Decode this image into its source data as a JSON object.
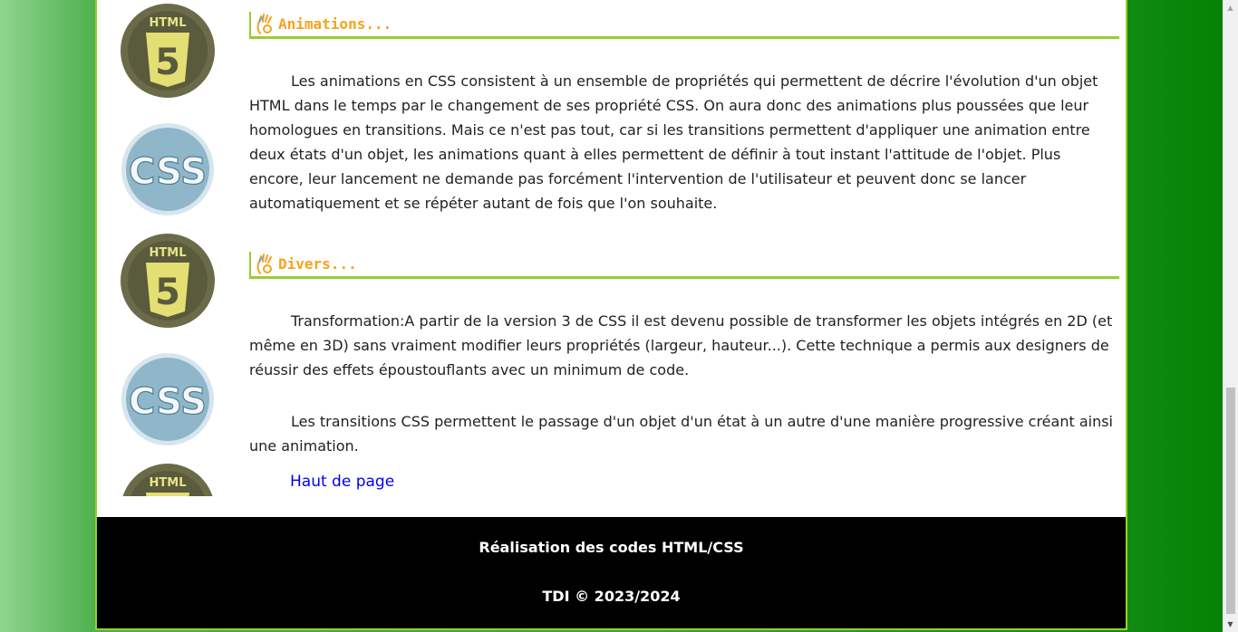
{
  "sections": [
    {
      "title": "Animations...",
      "paragraphs": [
        "Les animations en CSS consistent à un ensemble de propriétés qui permettent de décrire l'évolution d'un objet HTML dans le temps par le changement de ses propriété CSS. On aura donc des animations plus poussées que leur homologues en transitions. Mais ce n'est pas tout, car si les transitions permettent d'appliquer une animation entre deux états d'un objet, les animations quant à elles permettent de définir à tout instant l'attitude de l'objet. Plus encore, leur lancement ne demande pas forcément l'intervention de l'utilisateur et peuvent donc se lancer automatiquement et se répéter autant de fois que l'on souhaite."
      ]
    },
    {
      "title": "Divers...",
      "paragraphs": [
        "Transformation:A partir de la version 3 de CSS il est devenu possible de transformer les objets intégrés en 2D (et même en 3D) sans vraiment modifier leurs propriétés (largeur, hauteur...). Cette technique a permis aux designers de réussir des effets époustouflants avec un minimum de code.",
        "Les transitions CSS permettent le passage d'un objet d'un état à un autre d'une manière progressive créant ainsi une animation."
      ]
    }
  ],
  "top_link": "Haut de page",
  "logos": {
    "html_text": "HTML",
    "html_digit": "5",
    "css_text": "CSS"
  },
  "footer": {
    "line1": "Réalisation des codes HTML/CSS",
    "line2": "TDI © 2023/2024"
  },
  "colors": {
    "accent_green": "#9acd32",
    "title_orange": "#f7a21c",
    "link_blue": "#0000ee"
  }
}
